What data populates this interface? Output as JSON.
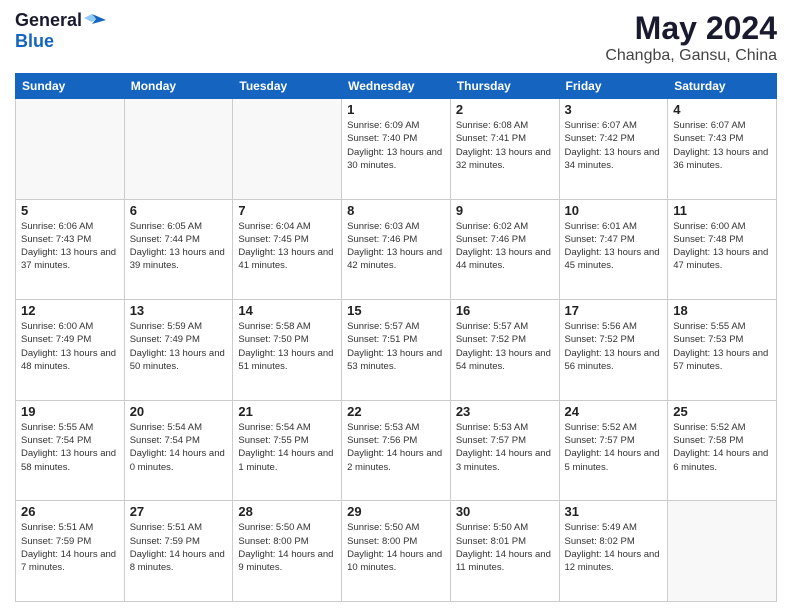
{
  "header": {
    "logo_general": "General",
    "logo_blue": "Blue",
    "title": "May 2024",
    "subtitle": "Changba, Gansu, China"
  },
  "calendar": {
    "days_of_week": [
      "Sunday",
      "Monday",
      "Tuesday",
      "Wednesday",
      "Thursday",
      "Friday",
      "Saturday"
    ],
    "weeks": [
      [
        {
          "day": "",
          "info": ""
        },
        {
          "day": "",
          "info": ""
        },
        {
          "day": "",
          "info": ""
        },
        {
          "day": "1",
          "info": "Sunrise: 6:09 AM\nSunset: 7:40 PM\nDaylight: 13 hours\nand 30 minutes."
        },
        {
          "day": "2",
          "info": "Sunrise: 6:08 AM\nSunset: 7:41 PM\nDaylight: 13 hours\nand 32 minutes."
        },
        {
          "day": "3",
          "info": "Sunrise: 6:07 AM\nSunset: 7:42 PM\nDaylight: 13 hours\nand 34 minutes."
        },
        {
          "day": "4",
          "info": "Sunrise: 6:07 AM\nSunset: 7:43 PM\nDaylight: 13 hours\nand 36 minutes."
        }
      ],
      [
        {
          "day": "5",
          "info": "Sunrise: 6:06 AM\nSunset: 7:43 PM\nDaylight: 13 hours\nand 37 minutes."
        },
        {
          "day": "6",
          "info": "Sunrise: 6:05 AM\nSunset: 7:44 PM\nDaylight: 13 hours\nand 39 minutes."
        },
        {
          "day": "7",
          "info": "Sunrise: 6:04 AM\nSunset: 7:45 PM\nDaylight: 13 hours\nand 41 minutes."
        },
        {
          "day": "8",
          "info": "Sunrise: 6:03 AM\nSunset: 7:46 PM\nDaylight: 13 hours\nand 42 minutes."
        },
        {
          "day": "9",
          "info": "Sunrise: 6:02 AM\nSunset: 7:46 PM\nDaylight: 13 hours\nand 44 minutes."
        },
        {
          "day": "10",
          "info": "Sunrise: 6:01 AM\nSunset: 7:47 PM\nDaylight: 13 hours\nand 45 minutes."
        },
        {
          "day": "11",
          "info": "Sunrise: 6:00 AM\nSunset: 7:48 PM\nDaylight: 13 hours\nand 47 minutes."
        }
      ],
      [
        {
          "day": "12",
          "info": "Sunrise: 6:00 AM\nSunset: 7:49 PM\nDaylight: 13 hours\nand 48 minutes."
        },
        {
          "day": "13",
          "info": "Sunrise: 5:59 AM\nSunset: 7:49 PM\nDaylight: 13 hours\nand 50 minutes."
        },
        {
          "day": "14",
          "info": "Sunrise: 5:58 AM\nSunset: 7:50 PM\nDaylight: 13 hours\nand 51 minutes."
        },
        {
          "day": "15",
          "info": "Sunrise: 5:57 AM\nSunset: 7:51 PM\nDaylight: 13 hours\nand 53 minutes."
        },
        {
          "day": "16",
          "info": "Sunrise: 5:57 AM\nSunset: 7:52 PM\nDaylight: 13 hours\nand 54 minutes."
        },
        {
          "day": "17",
          "info": "Sunrise: 5:56 AM\nSunset: 7:52 PM\nDaylight: 13 hours\nand 56 minutes."
        },
        {
          "day": "18",
          "info": "Sunrise: 5:55 AM\nSunset: 7:53 PM\nDaylight: 13 hours\nand 57 minutes."
        }
      ],
      [
        {
          "day": "19",
          "info": "Sunrise: 5:55 AM\nSunset: 7:54 PM\nDaylight: 13 hours\nand 58 minutes."
        },
        {
          "day": "20",
          "info": "Sunrise: 5:54 AM\nSunset: 7:54 PM\nDaylight: 14 hours\nand 0 minutes."
        },
        {
          "day": "21",
          "info": "Sunrise: 5:54 AM\nSunset: 7:55 PM\nDaylight: 14 hours\nand 1 minute."
        },
        {
          "day": "22",
          "info": "Sunrise: 5:53 AM\nSunset: 7:56 PM\nDaylight: 14 hours\nand 2 minutes."
        },
        {
          "day": "23",
          "info": "Sunrise: 5:53 AM\nSunset: 7:57 PM\nDaylight: 14 hours\nand 3 minutes."
        },
        {
          "day": "24",
          "info": "Sunrise: 5:52 AM\nSunset: 7:57 PM\nDaylight: 14 hours\nand 5 minutes."
        },
        {
          "day": "25",
          "info": "Sunrise: 5:52 AM\nSunset: 7:58 PM\nDaylight: 14 hours\nand 6 minutes."
        }
      ],
      [
        {
          "day": "26",
          "info": "Sunrise: 5:51 AM\nSunset: 7:59 PM\nDaylight: 14 hours\nand 7 minutes."
        },
        {
          "day": "27",
          "info": "Sunrise: 5:51 AM\nSunset: 7:59 PM\nDaylight: 14 hours\nand 8 minutes."
        },
        {
          "day": "28",
          "info": "Sunrise: 5:50 AM\nSunset: 8:00 PM\nDaylight: 14 hours\nand 9 minutes."
        },
        {
          "day": "29",
          "info": "Sunrise: 5:50 AM\nSunset: 8:00 PM\nDaylight: 14 hours\nand 10 minutes."
        },
        {
          "day": "30",
          "info": "Sunrise: 5:50 AM\nSunset: 8:01 PM\nDaylight: 14 hours\nand 11 minutes."
        },
        {
          "day": "31",
          "info": "Sunrise: 5:49 AM\nSunset: 8:02 PM\nDaylight: 14 hours\nand 12 minutes."
        },
        {
          "day": "",
          "info": ""
        }
      ]
    ]
  }
}
